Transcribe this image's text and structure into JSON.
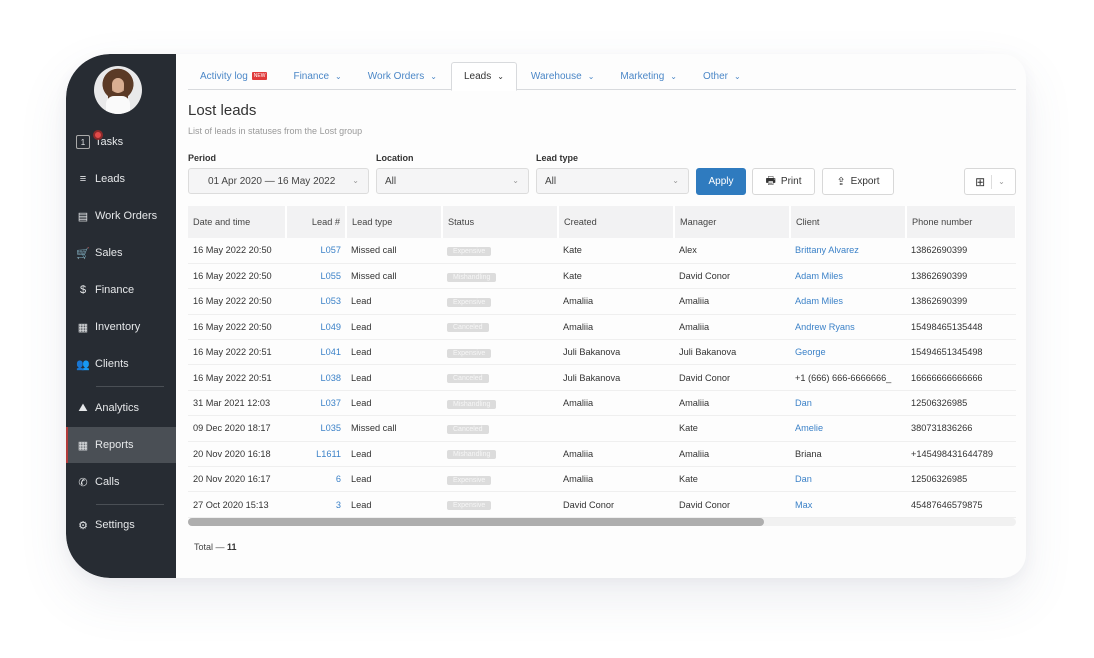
{
  "sidebar": {
    "items": [
      {
        "label": "Tasks",
        "icon": "tasks-icon",
        "badge": "1"
      },
      {
        "label": "Leads",
        "icon": "funnel-icon"
      },
      {
        "label": "Work Orders",
        "icon": "work-orders-icon"
      },
      {
        "label": "Sales",
        "icon": "cart-icon"
      },
      {
        "label": "Finance",
        "icon": "dollar-icon"
      },
      {
        "label": "Inventory",
        "icon": "boxes-icon"
      },
      {
        "label": "Clients",
        "icon": "users-icon"
      },
      {
        "label": "Analytics",
        "icon": "chart-icon"
      },
      {
        "label": "Reports",
        "icon": "table-icon",
        "active": true
      },
      {
        "label": "Calls",
        "icon": "phone-icon"
      },
      {
        "label": "Settings",
        "icon": "gear-icon"
      }
    ]
  },
  "tabs": [
    {
      "label": "Activity log",
      "badge": "NEW"
    },
    {
      "label": "Finance"
    },
    {
      "label": "Work Orders"
    },
    {
      "label": "Leads",
      "active": true
    },
    {
      "label": "Warehouse"
    },
    {
      "label": "Marketing"
    },
    {
      "label": "Other"
    }
  ],
  "page": {
    "title": "Lost leads",
    "subtitle": "List of leads in statuses from the Lost group"
  },
  "filters": {
    "period_label": "Period",
    "period_value": "01 Apr 2020 — 16 May 2022",
    "location_label": "Location",
    "location_value": "All",
    "lead_type_label": "Lead type",
    "lead_type_value": "All",
    "apply": "Apply",
    "print": "Print",
    "export": "Export"
  },
  "table": {
    "columns": [
      "Date and time",
      "Lead #",
      "Lead type",
      "Status",
      "Created",
      "Manager",
      "Client",
      "Phone number"
    ],
    "rows": [
      {
        "date": "16 May 2022 20:50",
        "lead": "L057",
        "type": "Missed call",
        "status": "Expensive",
        "created": "Kate",
        "manager": "Alex",
        "client": "Brittany Alvarez",
        "client_link": true,
        "phone": "13862690399"
      },
      {
        "date": "16 May 2022 20:50",
        "lead": "L055",
        "type": "Missed call",
        "status": "Mishandling",
        "created": "Kate",
        "manager": "David Conor",
        "client": "Adam Miles",
        "client_link": true,
        "phone": "13862690399"
      },
      {
        "date": "16 May 2022 20:50",
        "lead": "L053",
        "type": "Lead",
        "status": "Expensive",
        "created": "Amaliia",
        "manager": "Amaliia",
        "client": "Adam Miles",
        "client_link": true,
        "phone": "13862690399"
      },
      {
        "date": "16 May 2022 20:50",
        "lead": "L049",
        "type": "Lead",
        "status": "Canceled",
        "created": "Amaliia",
        "manager": "Amaliia",
        "client": "Andrew Ryans",
        "client_link": true,
        "phone": "15498465135448"
      },
      {
        "date": "16 May 2022 20:51",
        "lead": "L041",
        "type": "Lead",
        "status": "Expensive",
        "created": "Juli Bakanova",
        "manager": "Juli Bakanova",
        "client": "George",
        "client_link": true,
        "phone": "15494651345498"
      },
      {
        "date": "16 May 2022 20:51",
        "lead": "L038",
        "type": "Lead",
        "status": "Canceled",
        "created": "Juli Bakanova",
        "manager": "David Conor",
        "client": "+1 (666) 666-6666666_",
        "client_link": false,
        "phone": "16666666666666"
      },
      {
        "date": "31 Mar 2021 12:03",
        "lead": "L037",
        "type": "Lead",
        "status": "Mishandling",
        "created": "Amaliia",
        "manager": "Amaliia",
        "client": "Dan",
        "client_link": true,
        "phone": "12506326985"
      },
      {
        "date": "09 Dec 2020 18:17",
        "lead": "L035",
        "type": "Missed call",
        "status": "Canceled",
        "created": "",
        "manager": "Kate",
        "client": "Amelie",
        "client_link": true,
        "phone": "380731836266"
      },
      {
        "date": "20 Nov 2020 16:18",
        "lead": "L1611",
        "type": "Lead",
        "status": "Mishandling",
        "created": "Amaliia",
        "manager": "Amaliia",
        "client": "Briana",
        "client_link": false,
        "phone": "+145498431644789"
      },
      {
        "date": "20 Nov 2020 16:17",
        "lead": "6",
        "type": "Lead",
        "status": "Expensive",
        "created": "Amaliia",
        "manager": "Kate",
        "client": "Dan",
        "client_link": true,
        "phone": "12506326985"
      },
      {
        "date": "27 Oct 2020 15:13",
        "lead": "3",
        "type": "Lead",
        "status": "Expensive",
        "created": "David Conor",
        "manager": "David Conor",
        "client": "Max",
        "client_link": true,
        "phone": "45487646579875"
      }
    ]
  },
  "footer": {
    "total_label": "Total —",
    "total_value": "11"
  },
  "colors": {
    "accent": "#2f7bbf",
    "link": "#3c82c8",
    "sidebar": "#272c33",
    "badge": "#e03a3a"
  }
}
